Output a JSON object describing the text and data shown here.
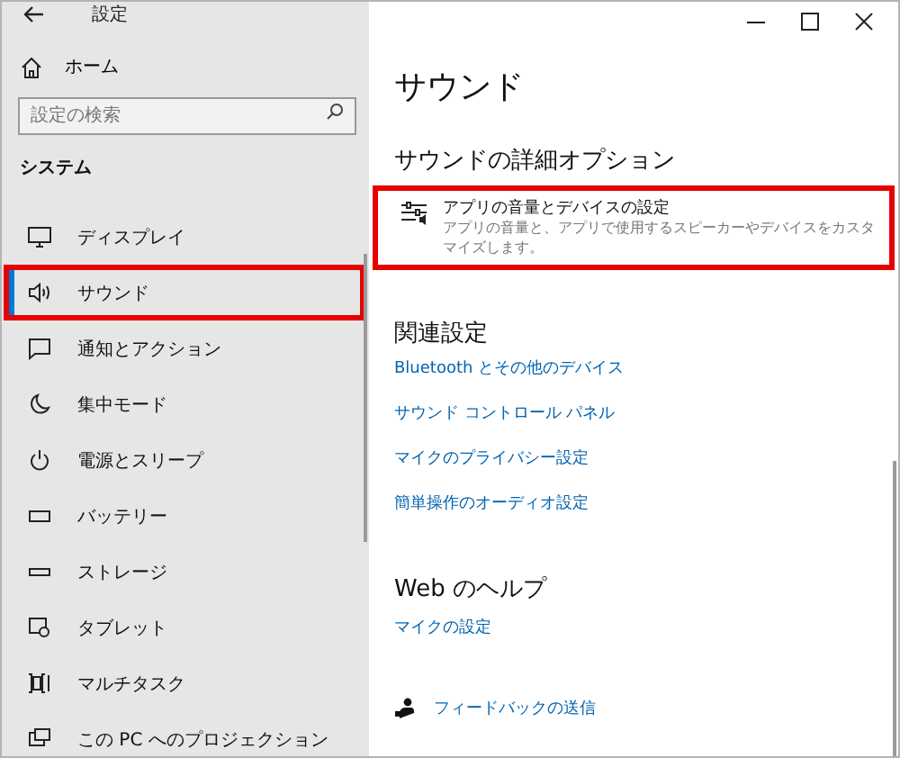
{
  "window": {
    "title": "設定"
  },
  "sidebar": {
    "home": "ホーム",
    "search": {
      "placeholder": "設定の検索"
    },
    "section": "システム",
    "items": [
      {
        "label": "ディスプレイ",
        "selected": false,
        "highlighted": false
      },
      {
        "label": "サウンド",
        "selected": true,
        "highlighted": true
      },
      {
        "label": "通知とアクション",
        "selected": false,
        "highlighted": false
      },
      {
        "label": "集中モード",
        "selected": false,
        "highlighted": false
      },
      {
        "label": "電源とスリープ",
        "selected": false,
        "highlighted": false
      },
      {
        "label": "バッテリー",
        "selected": false,
        "highlighted": false
      },
      {
        "label": "ストレージ",
        "selected": false,
        "highlighted": false
      },
      {
        "label": "タブレット",
        "selected": false,
        "highlighted": false
      },
      {
        "label": "マルチタスク",
        "selected": false,
        "highlighted": false
      },
      {
        "label": "この PC へのプロジェクション",
        "selected": false,
        "highlighted": false
      }
    ]
  },
  "content": {
    "title": "サウンド",
    "advanced_heading": "サウンドの詳細オプション",
    "option": {
      "title": "アプリの音量とデバイスの設定",
      "description": "アプリの音量と、アプリで使用するスピーカーやデバイスをカスタマイズします。",
      "highlighted": true
    },
    "related_heading": "関連設定",
    "related_links": [
      "Bluetooth とその他のデバイス",
      "サウンド コントロール パネル",
      "マイクのプライバシー設定",
      "簡単操作のオーディオ設定"
    ],
    "help_heading": "Web のヘルプ",
    "help_links": [
      "マイクの設定"
    ],
    "feedback": "フィードバックの送信"
  }
}
